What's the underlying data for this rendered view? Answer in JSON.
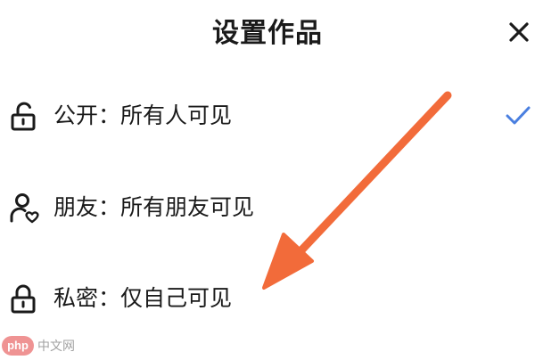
{
  "header": {
    "title": "设置作品",
    "close_icon": "close-icon"
  },
  "options": [
    {
      "label": "公开：所有人可见",
      "icon": "unlocked-padlock-icon",
      "selected": true
    },
    {
      "label": "朋友：所有朋友可见",
      "icon": "friend-heart-icon",
      "selected": false
    },
    {
      "label": "私密：仅自己可见",
      "icon": "locked-padlock-icon",
      "selected": false
    }
  ],
  "check_icon": "checkmark-icon",
  "colors": {
    "text": "#1a1a1a",
    "check": "#4a7fe0",
    "annotation_arrow": "#f26b3a",
    "watermark_logo": "#e23b3b"
  },
  "watermark": {
    "logo": "php",
    "text": "中文网"
  }
}
